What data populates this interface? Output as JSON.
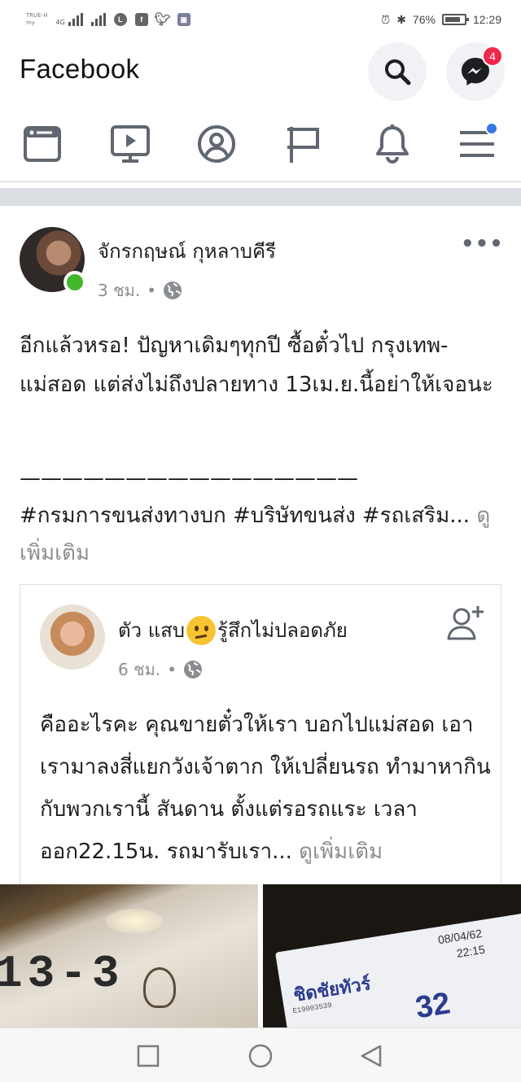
{
  "status_bar": {
    "carrier_line1": "TRUE-H",
    "carrier_line2": "my",
    "net1": "4G",
    "net2": "1",
    "battery": "76%",
    "time": "12:29",
    "app_icons": [
      "line-icon",
      "facebook-icon",
      "twitter-icon",
      "photo-icon"
    ]
  },
  "header": {
    "brand": "Facebook",
    "messenger_badge": "4"
  },
  "tabs": [
    {
      "icon": "news-feed-icon"
    },
    {
      "icon": "watch-icon"
    },
    {
      "icon": "profile-icon"
    },
    {
      "icon": "pages-flag-icon"
    },
    {
      "icon": "notifications-bell-icon"
    },
    {
      "icon": "menu-icon"
    }
  ],
  "post": {
    "author": "จักรกฤษณ์ กุหลาบคีรี",
    "time": "3 ชม.",
    "separator": "•",
    "text": "อีกแล้วหรอ! ปัญหาเดิมๆทุกปี ซื้อตั๋วไป กรุงเทพ-แม่สอด แต่ส่งไม่ถึงปลายทาง 13เม.ย.นี้อย่าให้เจอนะ",
    "divider": "————————————————",
    "hashtags": "#กรมการขนส่งทางบก #บริษัทขนส่ง #รถเสริม...",
    "see_more": "ดูเพิ่มเติม",
    "more_label": "•••"
  },
  "shared": {
    "author_part1": "ตัว แสบ",
    "author_part2": "รู้สึกไม่ปลอดภัย",
    "time": "6 ชม.",
    "separator": "•",
    "text": "คืออะไรคะ คุณขายตั๋วให้เรา บอกไปแม่สอด เอาเรามาลงสี่แยกวังเจ้าตาก ให้เปลี่ยนรถ  ทำมาหากินกับพวกเรานี้ สันดาน ตั้งแต่รอรถแระ เวลาออก22.15น.  รถมารับเรา...",
    "see_more": "ดูเพิ่มเติม"
  },
  "photos": {
    "left_number": "13-3",
    "ticket_name": "ชิดชัยทัวร์",
    "ticket_date": "08/04/62",
    "ticket_time": "22:15",
    "ticket_code": "E19003539",
    "ticket_seat": "32"
  },
  "colors": {
    "accent_blue": "#3578e5",
    "online_green": "#42b72a",
    "badge_red": "#f0284a",
    "muted_text": "#8a8d91"
  }
}
